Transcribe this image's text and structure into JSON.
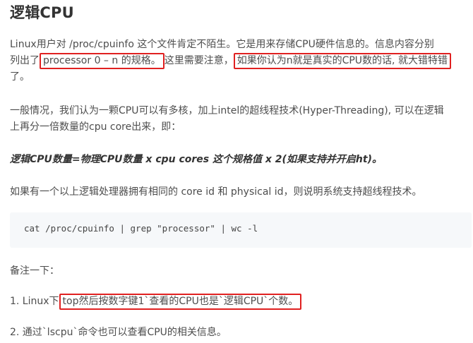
{
  "heading": "逻辑CPU",
  "para1": {
    "line1": "Linux用户对 /proc/cpuinfo 这个文件肯定不陌生。它是用来存储CPU硬件信息的。信息内容分别",
    "line2_prefix": "列出了",
    "line2_box1": "processor 0 – n 的规格。",
    "line2_mid": "这里需要注意，",
    "line2_box2": "如果你认为n就是真实的CPU数的话, 就大错特错",
    "line3": "了。"
  },
  "para2": {
    "line1": "一般情况，我们认为一颗CPU可以有多核，加上intel的超线程技术(Hyper-Threading), 可以在逻辑",
    "line2": "上再分一倍数量的cpu core出来，即："
  },
  "formula": "逻辑CPU数量=物理CPU数量 x cpu cores 这个规格值 x 2(如果支持并开启ht)。",
  "para3": "如果有一个以上逻辑处理器拥有相同的 core id 和 physical id，则说明系统支持超线程技术。",
  "code": "cat /proc/cpuinfo | grep \"processor\" | wc -l",
  "note_label": "备注一下：",
  "note1": {
    "prefix": "1. Linux下",
    "box": "top然后按数字键1`查看的CPU也是`逻辑CPU`个数。"
  },
  "note2": "2. 通过`lscpu`命令也可以查看CPU的相关信息。",
  "colors": {
    "highlight_border": "#e02020",
    "code_bg": "#f6f8fa"
  }
}
